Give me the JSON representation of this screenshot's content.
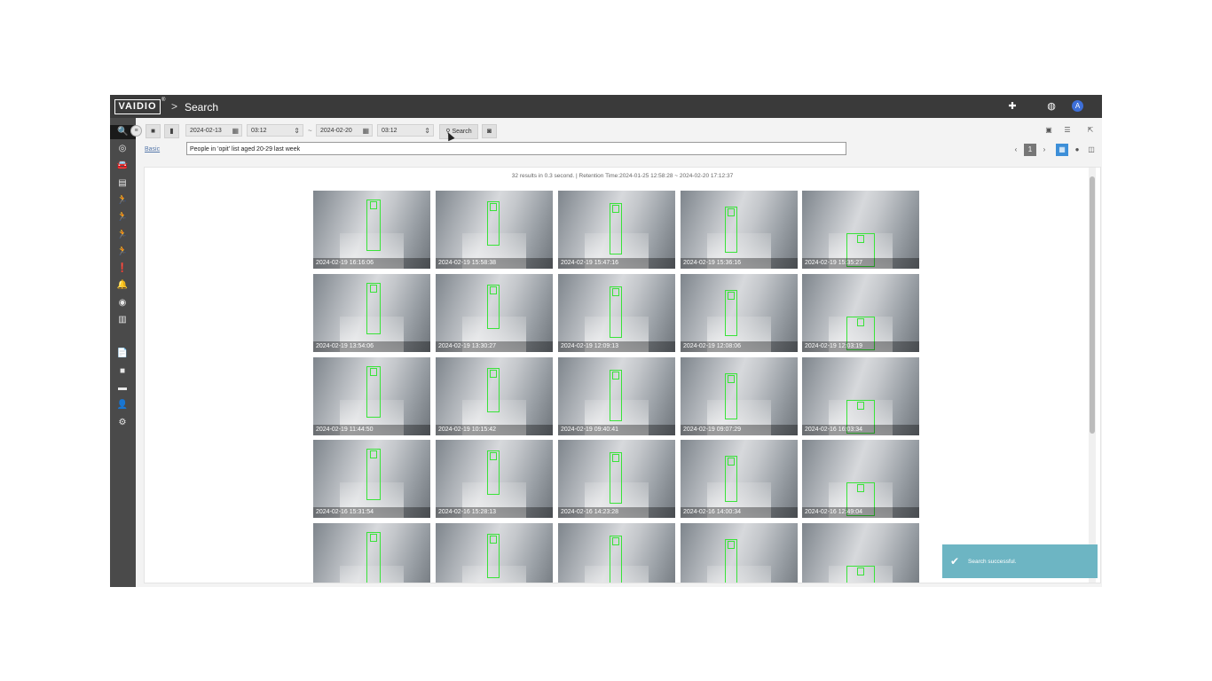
{
  "header": {
    "logo": "VAIDIO",
    "logo_mark": "®",
    "breadcrumb_sep": ">",
    "page_title": "Search",
    "icons": [
      "puzzle-icon",
      "globe-icon"
    ],
    "avatar_letter": "A"
  },
  "sidebar": {
    "collapse": "≡",
    "items": [
      {
        "name": "search-icon",
        "glyph": "🔍"
      },
      {
        "name": "face-scan-icon",
        "glyph": "◎"
      },
      {
        "name": "car-icon",
        "glyph": "🚘"
      },
      {
        "name": "id-card-icon",
        "glyph": "▤"
      },
      {
        "name": "person-run-icon",
        "glyph": "🏃"
      },
      {
        "name": "person-fall-icon",
        "glyph": "🏃"
      },
      {
        "name": "person-slide-icon",
        "glyph": "🏃"
      },
      {
        "name": "person-action-icon",
        "glyph": "🏃"
      },
      {
        "name": "alert-icon",
        "glyph": "❗"
      },
      {
        "name": "bell-icon",
        "glyph": "🔔"
      },
      {
        "name": "scan-icon",
        "glyph": "◉"
      },
      {
        "name": "chart-icon",
        "glyph": "▥"
      },
      {
        "name": "document-icon",
        "glyph": "📄"
      },
      {
        "name": "video-icon",
        "glyph": "■"
      },
      {
        "name": "tag-icon",
        "glyph": "▬"
      },
      {
        "name": "user-icon",
        "glyph": "👤"
      },
      {
        "name": "settings-icon",
        "glyph": "⚙"
      }
    ]
  },
  "toolbar": {
    "camera_glyph": "■",
    "file_glyph": "▮",
    "start_date": "2024-02-13",
    "start_time": "03:12",
    "range_sep": "~",
    "end_date": "2024-02-20",
    "end_time": "03:12",
    "calendar_glyph": "▦",
    "spinner_glyph": "⇕",
    "search_label": "Search",
    "search_icon_glyph": "⚲",
    "snapshot_glyph": "◙",
    "mode_link": "Basic",
    "query": "People in 'opit' list aged 20-29 last week",
    "right_icons": [
      "save-icon",
      "list-icon",
      "export-icon"
    ],
    "page_prev": "‹",
    "page_current": "1",
    "page_next": "›",
    "view_icons": [
      "grid-view-icon",
      "map-view-icon",
      "split-view-icon"
    ]
  },
  "results": {
    "summary": "32 results in 0.3 second. | Retention Time:2024-01-25 12:58:28 ~ 2024-02-20 17:12:37",
    "items": [
      {
        "ts": "2024-02-19 16:16:06"
      },
      {
        "ts": "2024-02-19 15:58:38"
      },
      {
        "ts": "2024-02-19 15:47:16"
      },
      {
        "ts": "2024-02-19 15:36:16"
      },
      {
        "ts": "2024-02-19 15:35:27"
      },
      {
        "ts": "2024-02-19 13:54:06"
      },
      {
        "ts": "2024-02-19 13:30:27"
      },
      {
        "ts": "2024-02-19 12:09:13"
      },
      {
        "ts": "2024-02-19 12:08:06"
      },
      {
        "ts": "2024-02-19 12:03:19"
      },
      {
        "ts": "2024-02-19 11:44:50"
      },
      {
        "ts": "2024-02-19 10:15:42"
      },
      {
        "ts": "2024-02-19 09:40:41"
      },
      {
        "ts": "2024-02-19 09:07:29"
      },
      {
        "ts": "2024-02-16 16:03:34"
      },
      {
        "ts": "2024-02-16 15:31:54"
      },
      {
        "ts": "2024-02-16 15:28:13"
      },
      {
        "ts": "2024-02-16 14:23:28"
      },
      {
        "ts": "2024-02-16 14:00:34"
      },
      {
        "ts": "2024-02-16 12:49:04"
      },
      {
        "ts": ""
      },
      {
        "ts": ""
      },
      {
        "ts": ""
      },
      {
        "ts": ""
      },
      {
        "ts": ""
      }
    ]
  },
  "toast": {
    "check_glyph": "✔",
    "message": "Search successful."
  },
  "colors": {
    "topbar": "#3a3a3a",
    "sidebar": "#4a4a4a",
    "bbox": "#39e339",
    "toast": "#6db5c3",
    "avatar": "#3d6fd8"
  }
}
